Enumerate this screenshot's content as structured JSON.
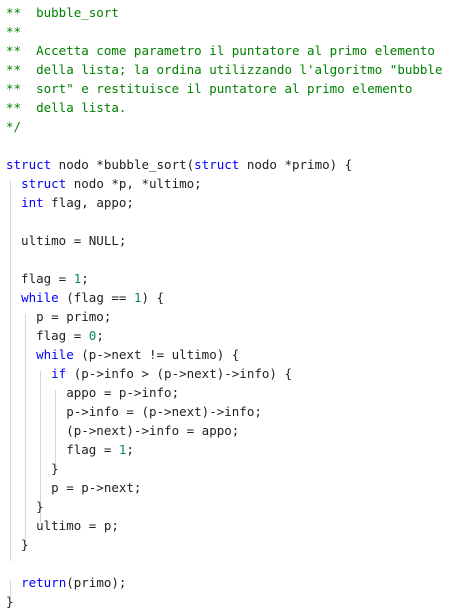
{
  "editor": {
    "lines": [
      [
        {
          "t": "comment",
          "v": "**  bubble_sort"
        }
      ],
      [
        {
          "t": "comment",
          "v": "**"
        }
      ],
      [
        {
          "t": "comment",
          "v": "**  Accetta come parametro il puntatore al primo elemento"
        }
      ],
      [
        {
          "t": "comment",
          "v": "**  della lista; la ordina utilizzando l'algoritmo \"bubble"
        }
      ],
      [
        {
          "t": "comment",
          "v": "**  sort\" e restituisce il puntatore al primo elemento"
        }
      ],
      [
        {
          "t": "comment",
          "v": "**  della lista."
        }
      ],
      [
        {
          "t": "comment",
          "v": "*/"
        }
      ],
      [],
      [
        {
          "t": "keyword",
          "v": "struct"
        },
        {
          "t": "plain",
          "v": " nodo *bubble_sort("
        },
        {
          "t": "keyword",
          "v": "struct"
        },
        {
          "t": "plain",
          "v": " nodo *primo) {"
        }
      ],
      [
        {
          "t": "plain",
          "v": "  "
        },
        {
          "t": "keyword",
          "v": "struct"
        },
        {
          "t": "plain",
          "v": " nodo *p, *ultimo;"
        }
      ],
      [
        {
          "t": "plain",
          "v": "  "
        },
        {
          "t": "keyword",
          "v": "int"
        },
        {
          "t": "plain",
          "v": " flag, appo;"
        }
      ],
      [],
      [
        {
          "t": "plain",
          "v": "  ultimo = NULL;"
        }
      ],
      [],
      [
        {
          "t": "plain",
          "v": "  flag = "
        },
        {
          "t": "number",
          "v": "1"
        },
        {
          "t": "plain",
          "v": ";"
        }
      ],
      [
        {
          "t": "plain",
          "v": "  "
        },
        {
          "t": "keyword",
          "v": "while"
        },
        {
          "t": "plain",
          "v": " (flag == "
        },
        {
          "t": "number",
          "v": "1"
        },
        {
          "t": "plain",
          "v": ") {"
        }
      ],
      [
        {
          "t": "plain",
          "v": "    p = primo;"
        }
      ],
      [
        {
          "t": "plain",
          "v": "    flag = "
        },
        {
          "t": "number",
          "v": "0"
        },
        {
          "t": "plain",
          "v": ";"
        }
      ],
      [
        {
          "t": "plain",
          "v": "    "
        },
        {
          "t": "keyword",
          "v": "while"
        },
        {
          "t": "plain",
          "v": " (p->next != ultimo) {"
        }
      ],
      [
        {
          "t": "plain",
          "v": "      "
        },
        {
          "t": "keyword",
          "v": "if"
        },
        {
          "t": "plain",
          "v": " (p->info > (p->next)->info) {"
        }
      ],
      [
        {
          "t": "plain",
          "v": "        appo = p->info;"
        }
      ],
      [
        {
          "t": "plain",
          "v": "        p->info = (p->next)->info;"
        }
      ],
      [
        {
          "t": "plain",
          "v": "        (p->next)->info = appo;"
        }
      ],
      [
        {
          "t": "plain",
          "v": "        flag = "
        },
        {
          "t": "number",
          "v": "1"
        },
        {
          "t": "plain",
          "v": ";"
        }
      ],
      [
        {
          "t": "plain",
          "v": "      }"
        }
      ],
      [
        {
          "t": "plain",
          "v": "      p = p->next;"
        }
      ],
      [
        {
          "t": "plain",
          "v": "    }"
        }
      ],
      [
        {
          "t": "plain",
          "v": "    ultimo = p;"
        }
      ],
      [
        {
          "t": "plain",
          "v": "  }"
        }
      ],
      [],
      [
        {
          "t": "plain",
          "v": "  "
        },
        {
          "t": "keyword",
          "v": "return"
        },
        {
          "t": "plain",
          "v": "(primo);"
        }
      ],
      [
        {
          "t": "plain",
          "v": "}"
        }
      ]
    ],
    "colors": {
      "background": "#ffffff",
      "comment": "#008000",
      "keyword": "#0000ff",
      "number": "#098658",
      "text": "#1f1f1f",
      "indent_guide": "#d6d6d6"
    }
  }
}
